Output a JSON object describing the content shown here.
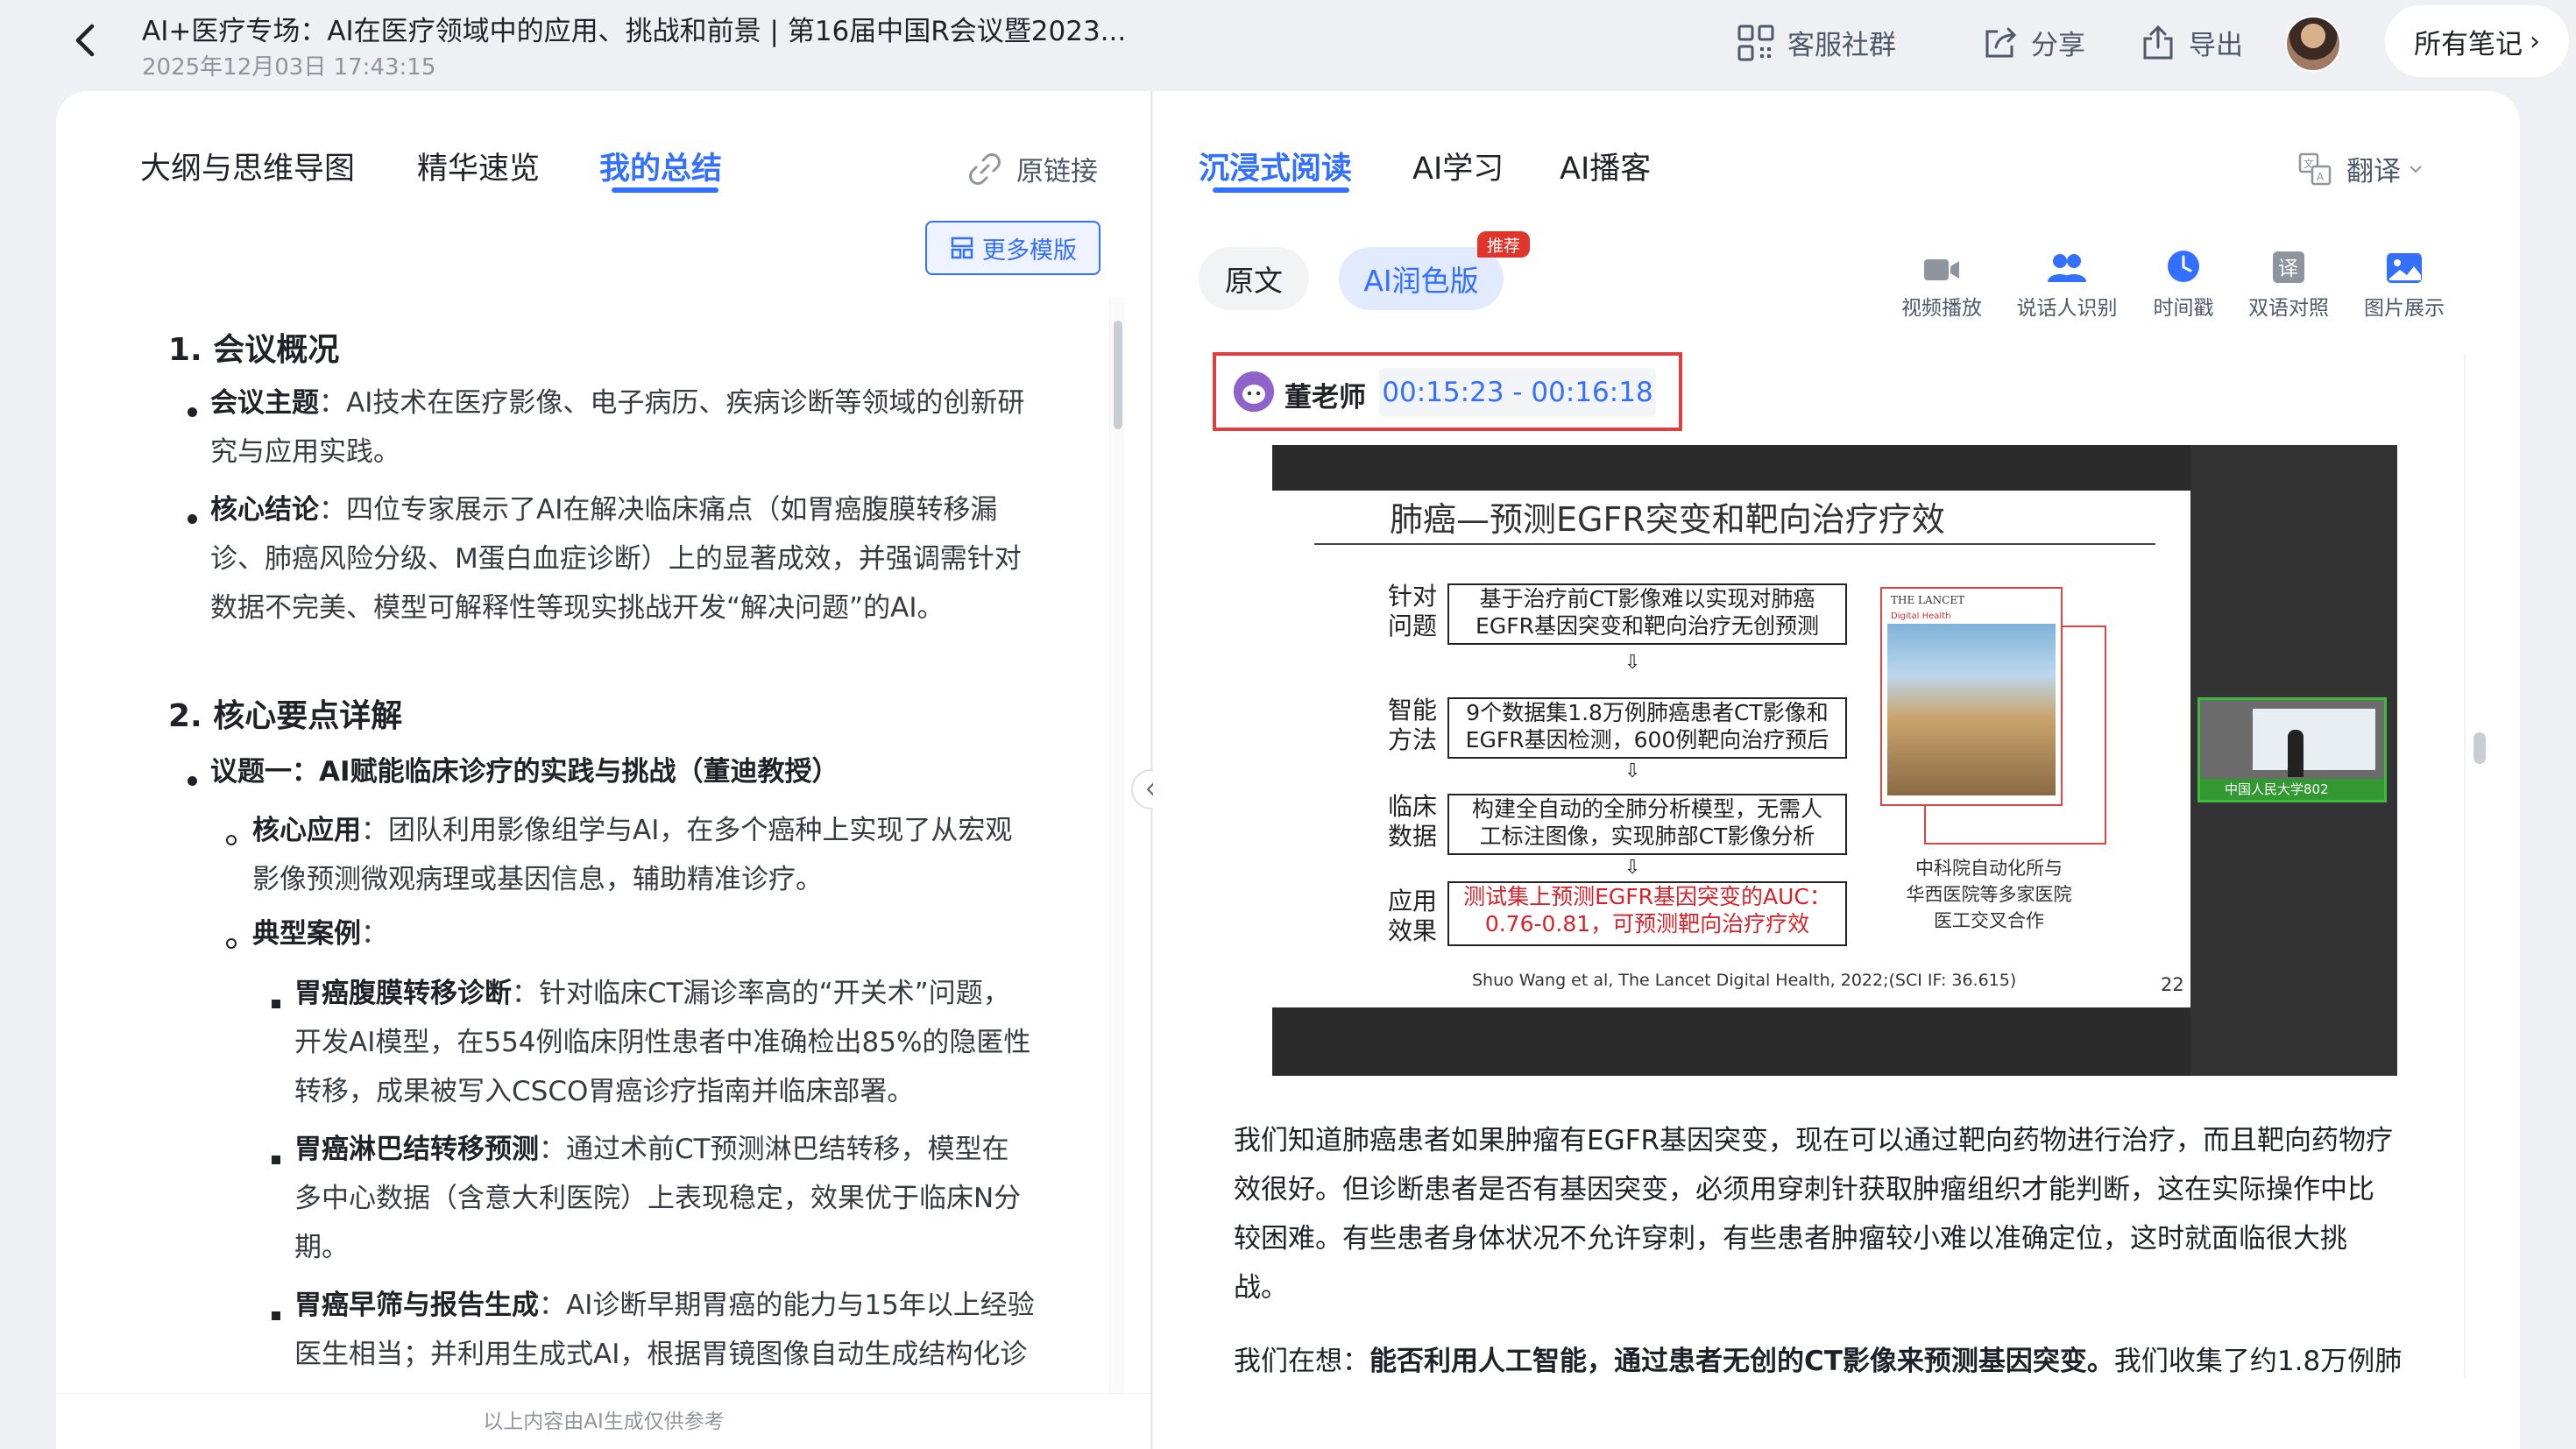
{
  "header": {
    "title": "AI+医疗专场：AI在医疗领域中的应用、挑战和前景 | 第16届中国R会议暨2023...",
    "date": "2025年12月03日 17:43:15",
    "actions": {
      "service": "客服社群",
      "share": "分享",
      "export": "导出",
      "all_notes": "所有笔记"
    }
  },
  "left": {
    "tabs": [
      "大纲与思维导图",
      "精华速览",
      "我的总结"
    ],
    "active_tab": 2,
    "origin_link": "原链接",
    "more_templates": "更多模版",
    "footer": "以上内容由AI生成仅供参考",
    "summary": {
      "section1_title": "1. 会议概况",
      "theme_label": "会议主题",
      "theme_line1": "：AI技术在医疗影像、电子病历、疾病诊断等领域的创新研",
      "theme_line2": "究与应用实践。",
      "conclusion_label": "核心结论",
      "conclusion_line1": "：四位专家展示了AI在解决临床痛点（如胃癌腹膜转移漏",
      "conclusion_line2": "诊、肺癌风险分级、M蛋白血症诊断）上的显著成效，并强调需针对",
      "conclusion_line3": "数据不完美、模型可解释性等现实挑战开发“解决问题”的AI。",
      "section2_title": "2. 核心要点详解",
      "topic1": "议题一：AI赋能临床诊疗的实践与挑战（董迪教授）",
      "core_app_label": "核心应用",
      "core_app_line1": "：团队利用影像组学与AI，在多个癌种上实现了从宏观",
      "core_app_line2": "影像预测微观病理或基因信息，辅助精准诊疗。",
      "cases_label": "典型案例",
      "cases_colon": "：",
      "case1_label": "胃癌腹膜转移诊断",
      "case1_line1": "：针对临床CT漏诊率高的“开关术”问题，",
      "case1_line2": "开发AI模型，在554例临床阴性患者中准确检出85%的隐匿性",
      "case1_line3": "转移，成果被写入CSCO胃癌诊疗指南并临床部署。",
      "case2_label": "胃癌淋巴结转移预测",
      "case2_line1": "：通过术前CT预测淋巴结转移，模型在",
      "case2_line2": "多中心数据（含意大利医院）上表现稳定，效果优于临床N分",
      "case2_line3": "期。",
      "case3_label": "胃癌早筛与报告生成",
      "case3_line1": "：AI诊断早期胃癌的能力与15年以上经验",
      "case3_line2": "医生相当；并利用生成式AI，根据胃镜图像自动生成结构化诊"
    }
  },
  "right": {
    "tabs": [
      "沉浸式阅读",
      "AI学习",
      "AI播客"
    ],
    "active_tab": 0,
    "translate": "翻译",
    "version_pills": [
      "原文",
      "AI润色版"
    ],
    "recommend_badge": "推荐",
    "tools": [
      "视频播放",
      "说话人识别",
      "时间戳",
      "双语对照",
      "图片展示"
    ],
    "speaker": {
      "name": "董老师",
      "time_range": "00:15:23 - 00:16:18"
    },
    "slide": {
      "title": "肺癌—预测EGFR突变和靶向治疗疗效",
      "rows": [
        {
          "label1": "针对",
          "label2": "问题",
          "box1": "基于治疗前CT影像难以实现对肺癌",
          "box2": "EGFR基因突变和靶向治疗无创预测"
        },
        {
          "label1": "智能",
          "label2": "方法",
          "box1": "9个数据集1.8万例肺癌患者CT影像和",
          "box2": "EGFR基因检测，600例靶向治疗预后"
        },
        {
          "label1": "临床",
          "label2": "数据",
          "box1": "构建全自动的全肺分析模型，无需人",
          "box2": "工标注图像，实现肺部CT影像分析"
        },
        {
          "label1": "应用",
          "label2": "效果",
          "box1": "测试集上预测EGFR基因突变的AUC：",
          "box2": "0.76-0.81，可预测靶向治疗疗效"
        }
      ],
      "arrow": "⇩",
      "lancet_title": "THE LANCET",
      "lancet_sub": "Digital Health",
      "caption": [
        "中科院自动化所与",
        "华西医院等多家医院",
        "医工交叉合作"
      ],
      "citation": "Shuo Wang et al, The Lancet Digital Health, 2022;(SCI IF: 36.615)",
      "page": "22",
      "video_label": "中国人民大学802"
    },
    "article": {
      "p1_l1": "我们知道肺癌患者如果肿瘤有EGFR基因突变，现在可以通过靶向药物进行治疗，而且靶向药物疗",
      "p1_l2": "效很好。但诊断患者是否有基因突变，必须用穿刺针获取肿瘤组织才能判断，这在实际操作中比",
      "p1_l3": "较困难。有些患者身体状况不允许穿刺，有些患者肿瘤较小难以准确定位，这时就面临很大挑",
      "p1_l4": "战。",
      "p2_start": "我们在想：",
      "p2_bold": "能否利用人工智能，通过患者无创的CT影像来预测基因突变。",
      "p2_end": "我们收集了约1.8万例肺"
    }
  },
  "colors": {
    "accent": "#3370ff",
    "highlight_border": "#e03e3e",
    "badge": "#e0352b"
  }
}
